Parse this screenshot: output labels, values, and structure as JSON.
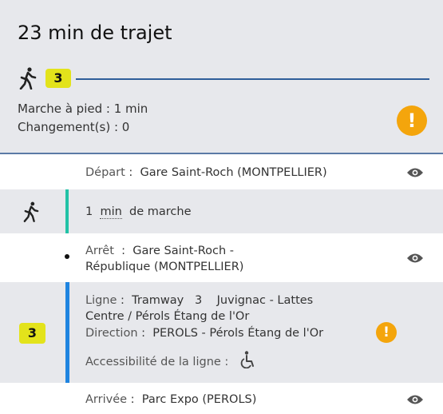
{
  "summary": {
    "title": "23 min de trajet",
    "line_badge": "3",
    "walk_label": "Marche à pied",
    "walk_value": "1 min",
    "changes_label": "Changement(s)",
    "changes_value": "0",
    "warning_icon": "!"
  },
  "steps": {
    "depart": {
      "label": "Départ",
      "value": "Gare Saint-Roch (MONTPELLIER)"
    },
    "walk": {
      "amount": "1",
      "unit": "min",
      "text": "de marche"
    },
    "stop": {
      "label": "Arrêt",
      "value_line1": "Gare Saint-Roch -",
      "value_line2": "République (MONTPELLIER)"
    },
    "line": {
      "badge": "3",
      "ligne_label": "Ligne",
      "ligne_value_line1": "Tramway   3    Juvignac - Lattes",
      "ligne_value_line2": "Centre / Pérols Étang de l'Or",
      "direction_label": "Direction",
      "direction_value": "PEROLS - Pérols Étang de l'Or",
      "accessibility_label": "Accessibilité de la ligne :",
      "warning_icon": "!"
    },
    "arrival": {
      "label": "Arrivée",
      "value": "Parc Expo (PEROLS)"
    }
  },
  "colors": {
    "line_badge": "#e3e31b",
    "walk_bar": "#22c2a6",
    "line_bar": "#1f84e0",
    "warning": "#f4a50c",
    "summary_bg": "#e7e8ec"
  }
}
